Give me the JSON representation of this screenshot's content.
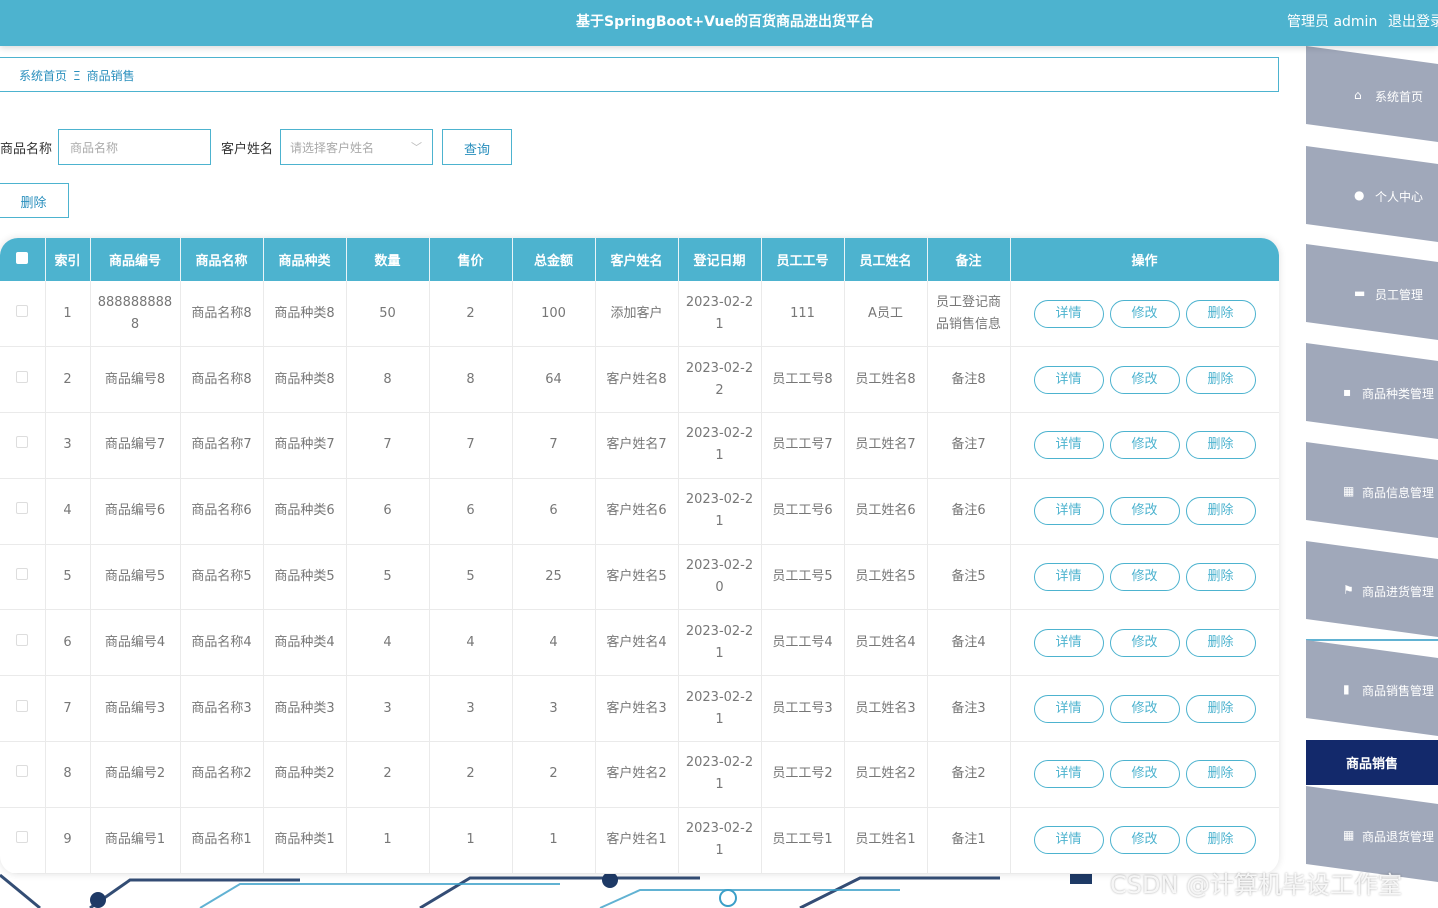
{
  "header": {
    "title": "基于SpringBoot+Vue的百货商品进出货平台",
    "user_label": "管理员 admin",
    "logout_label": "退出登录"
  },
  "breadcrumb": {
    "home": "系统首页",
    "separator": "Ξ",
    "current": "商品销售"
  },
  "search": {
    "product_name_label": "商品名称",
    "product_name_placeholder": "商品名称",
    "customer_label": "客户姓名",
    "customer_placeholder": "请选择客户姓名",
    "query_label": "查询",
    "delete_label": "删除"
  },
  "table": {
    "columns": [
      "索引",
      "商品编号",
      "商品名称",
      "商品种类",
      "数量",
      "售价",
      "总金额",
      "客户姓名",
      "登记日期",
      "员工工号",
      "员工姓名",
      "备注",
      "操作"
    ],
    "action_labels": {
      "detail": "详情",
      "edit": "修改",
      "delete": "删除"
    },
    "rows": [
      [
        "1",
        "8888888888",
        "商品名称8",
        "商品种类8",
        "50",
        "2",
        "100",
        "添加客户",
        "2023-02-21",
        "111",
        "A员工",
        "员工登记商品销售信息"
      ],
      [
        "2",
        "商品编号8",
        "商品名称8",
        "商品种类8",
        "8",
        "8",
        "64",
        "客户姓名8",
        "2023-02-22",
        "员工工号8",
        "员工姓名8",
        "备注8"
      ],
      [
        "3",
        "商品编号7",
        "商品名称7",
        "商品种类7",
        "7",
        "7",
        "7",
        "客户姓名7",
        "2023-02-21",
        "员工工号7",
        "员工姓名7",
        "备注7"
      ],
      [
        "4",
        "商品编号6",
        "商品名称6",
        "商品种类6",
        "6",
        "6",
        "6",
        "客户姓名6",
        "2023-02-21",
        "员工工号6",
        "员工姓名6",
        "备注6"
      ],
      [
        "5",
        "商品编号5",
        "商品名称5",
        "商品种类5",
        "5",
        "5",
        "25",
        "客户姓名5",
        "2023-02-20",
        "员工工号5",
        "员工姓名5",
        "备注5"
      ],
      [
        "6",
        "商品编号4",
        "商品名称4",
        "商品种类4",
        "4",
        "4",
        "4",
        "客户姓名4",
        "2023-02-21",
        "员工工号4",
        "员工姓名4",
        "备注4"
      ],
      [
        "7",
        "商品编号3",
        "商品名称3",
        "商品种类3",
        "3",
        "3",
        "3",
        "客户姓名3",
        "2023-02-21",
        "员工工号3",
        "员工姓名3",
        "备注3"
      ],
      [
        "8",
        "商品编号2",
        "商品名称2",
        "商品种类2",
        "2",
        "2",
        "2",
        "客户姓名2",
        "2023-02-21",
        "员工工号2",
        "员工姓名2",
        "备注2"
      ],
      [
        "9",
        "商品编号1",
        "商品名称1",
        "商品种类1",
        "1",
        "1",
        "1",
        "客户姓名1",
        "2023-02-21",
        "员工工号1",
        "员工姓名1",
        "备注1"
      ]
    ]
  },
  "sidebar": {
    "items": [
      {
        "label": "系统首页",
        "icon": "home-icon",
        "glyph": "⌂"
      },
      {
        "label": "个人中心",
        "icon": "user-icon",
        "glyph": "●"
      },
      {
        "label": "员工管理",
        "icon": "briefcase-icon",
        "glyph": "▬"
      },
      {
        "label": "商品种类管理",
        "icon": "comment-icon",
        "glyph": "▪"
      },
      {
        "label": "商品信息管理",
        "icon": "grid-icon",
        "glyph": "▦"
      },
      {
        "label": "商品进货管理",
        "icon": "flag-icon",
        "glyph": "⚑"
      },
      {
        "label": "商品销售管理",
        "icon": "bar-chart-icon",
        "glyph": "▮"
      },
      {
        "label": "商品退货管理",
        "icon": "grid-icon",
        "glyph": "▦"
      }
    ],
    "active_sub": "商品销售"
  },
  "watermark": "CSDN @计算机毕设工作室",
  "colors": {
    "primary": "#4db3cf",
    "active_menu": "#13296b",
    "menu_bg": "#a0a8ba"
  }
}
